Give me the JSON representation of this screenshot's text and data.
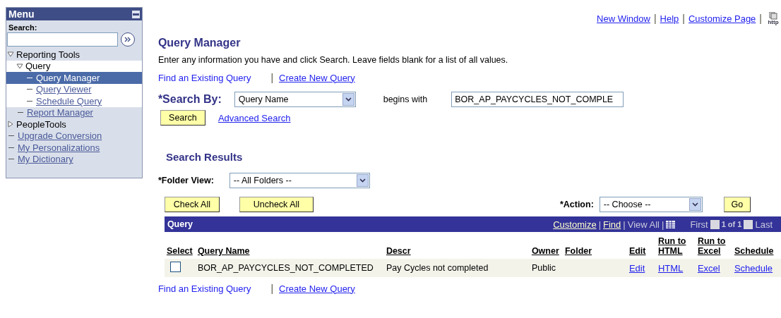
{
  "menu": {
    "title": "Menu",
    "search_label": "Search:",
    "items": [
      {
        "label": "Reporting Tools",
        "kind": "folder",
        "expanded": true,
        "children": [
          {
            "label": "Query",
            "kind": "folder",
            "expanded": true,
            "children": [
              {
                "label": "Query Manager",
                "kind": "link",
                "selected": true
              },
              {
                "label": "Query Viewer",
                "kind": "link",
                "selected": false
              },
              {
                "label": "Schedule Query",
                "kind": "link",
                "selected": false
              }
            ]
          },
          {
            "label": "Report Manager",
            "kind": "link",
            "selected": false
          }
        ]
      },
      {
        "label": "PeopleTools",
        "kind": "folder",
        "expanded": false
      },
      {
        "label": "Upgrade Conversion",
        "kind": "link",
        "selected": false
      },
      {
        "label": "My Personalizations",
        "kind": "link",
        "selected": false
      },
      {
        "label": "My Dictionary",
        "kind": "link",
        "selected": false
      }
    ]
  },
  "top_links": [
    "New Window",
    "Help",
    "Customize Page"
  ],
  "top_separator": "|",
  "top_icon_text": "http",
  "page": {
    "title": "Query Manager",
    "instructions": "Enter any information you have and click Search. Leave fields blank for a list of all values.",
    "find_link": "Find an Existing Query",
    "separator": "|",
    "create_link": "Create New Query",
    "search_by_label": "*Search By:",
    "search_by": "Query Name",
    "operator": "begins with",
    "search_value": "BOR_AP_PAYCYCLES_NOT_COMPLE",
    "search_button": "Search",
    "advanced_link": "Advanced Search"
  },
  "results": {
    "title": "Search Results",
    "folder_label": "*Folder View:",
    "folder": "-- All Folders --",
    "check_all": "Check All",
    "uncheck_all": "Uncheck All",
    "action_label": "*Action:",
    "action": "-- Choose --",
    "go": "Go",
    "grid": {
      "title": "Query",
      "nav_links": [
        "Customize",
        "Find"
      ],
      "separator": "|",
      "view_all": "View All",
      "first": "First",
      "page": "1 of 1",
      "last": "Last",
      "columns": [
        "Select",
        "Query Name",
        "Descr",
        "Owner",
        "Folder",
        "Edit",
        "Run to HTML",
        "Run to Excel",
        "Schedule"
      ],
      "rows": [
        {
          "checked": false,
          "query_name": "BOR_AP_PAYCYCLES_NOT_COMPLETED",
          "descr": "Pay Cycles not completed",
          "owner": "Public",
          "edit": "Edit",
          "html": "HTML",
          "excel": "Excel",
          "schedule": "Schedule"
        }
      ]
    }
  },
  "bottom": {
    "find_link": "Find an Existing Query",
    "separator": "|",
    "create_link": "Create New Query"
  }
}
